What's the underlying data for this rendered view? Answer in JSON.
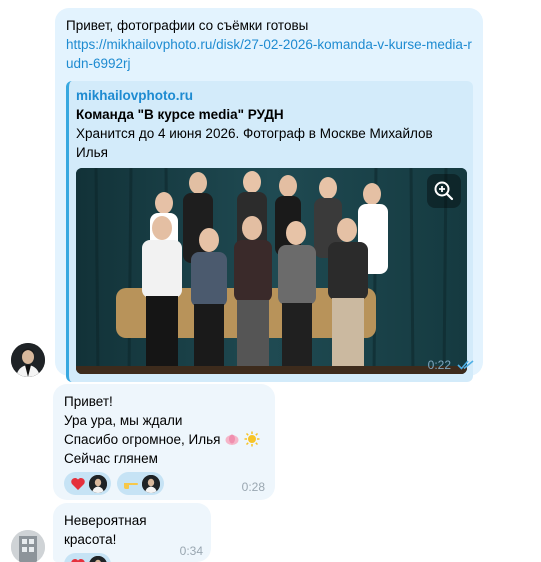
{
  "messages": {
    "first": {
      "text": "Привет, фотографии со съёмки готовы",
      "link": "https://mikhailovphoto.ru/disk/27-02-2026-komanda-v-kurse-media-rudn-6992rj",
      "preview": {
        "site": "mikhailovphoto.ru",
        "title": "Команда \"В курсе media\" РУДН",
        "description": "Хранится до 4 июня 2026. Фотограф в Москве Михайлов Илья"
      },
      "time": "0:22"
    },
    "second": {
      "lines": [
        "Привет!",
        "Ура ура, мы ждали",
        "Спасибо огромное, Илья",
        "Сейчас глянем"
      ],
      "time": "0:28",
      "reactions": [
        "heart",
        "point"
      ]
    },
    "third": {
      "text": "Невероятная красота!",
      "time": "0:34",
      "reactions": [
        "heart"
      ]
    }
  },
  "colors": {
    "outgoing_bubble": "#e3f3fe",
    "incoming_bubble": "#eef6fc",
    "link": "#1e8bd1",
    "preview_bar": "#37a8e0",
    "read_checks": "#4fb0e6"
  },
  "icons": [
    "zoom-icon",
    "double-check-icon",
    "heart-icon",
    "point-hand-icon",
    "lotus-icon",
    "sun-icon"
  ]
}
